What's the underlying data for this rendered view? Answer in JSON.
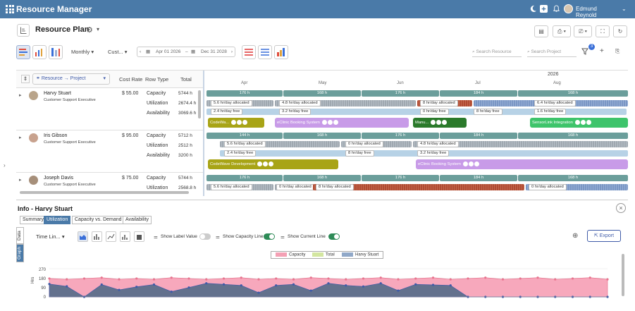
{
  "app": {
    "title": "Resource Manager",
    "user": "Edmund Reynold"
  },
  "page": {
    "title": "Resource Plan"
  },
  "toolbar": {
    "view_mode": "Monthly",
    "range_mode": "Cust...",
    "start_date": "Apr 01 2026",
    "end_date": "Dec 31 2028",
    "search_resource_placeholder": "Search Resource",
    "search_project_placeholder": "Search Project",
    "filter_count": "3"
  },
  "grid": {
    "headers": {
      "group": "Resource → Project",
      "cost": "Cost Rate",
      "row_type": "Row Type",
      "total": "Total"
    },
    "year": "2026",
    "months": [
      "Apr",
      "May",
      "Jun",
      "Jul",
      "Aug"
    ],
    "resources": [
      {
        "name": "Harvy Stuart",
        "role": "Customer Support Executive",
        "cost": "$ 55.00",
        "rows": [
          {
            "type": "Capacity",
            "total": "5744 h"
          },
          {
            "type": "Utilization",
            "total": "2674.4 h"
          },
          {
            "type": "Availability",
            "total": "3069.6 h"
          }
        ],
        "capacity": [
          "176 h",
          "168 h",
          "176 h",
          "184 h",
          "168 h"
        ],
        "utilization": [
          "5.6 hr/day allocated",
          "4.8 hr/day allocated",
          "8 hr/day allocated",
          "6.4 hr/day allocated"
        ],
        "availability": [
          "2.4 hr/day free",
          "3.2 hr/day free",
          "0 hr/day free",
          "8 hr/day free",
          "1.6 hr/day free"
        ],
        "projects": [
          "CodeWa...",
          "eClinic Booking System",
          "Manu...",
          "SensorLink Integration"
        ]
      },
      {
        "name": "Iris Gibson",
        "role": "Customer Support Executive",
        "cost": "$ 95.00",
        "rows": [
          {
            "type": "Capacity",
            "total": "5712 h"
          },
          {
            "type": "Utilization",
            "total": "2512 h"
          },
          {
            "type": "Availability",
            "total": "3200 h"
          }
        ],
        "capacity": [
          "144 h",
          "168 h",
          "176 h",
          "184 h",
          "168 h"
        ],
        "utilization": [
          "5.6 hr/day allocated",
          "0 hr/day allocated",
          "4.8 hr/day allocated"
        ],
        "availability": [
          "2.4 hr/day free",
          "8 hr/day free",
          "3.2 hr/day free"
        ],
        "projects": [
          "CodeWave Development",
          "eClinic Booking System"
        ]
      },
      {
        "name": "Joseph Davis",
        "role": "Customer Support Executive",
        "cost": "$ 75.00",
        "rows": [
          {
            "type": "Capacity",
            "total": "5744 h"
          },
          {
            "type": "Utilization",
            "total": "2568.8 h"
          }
        ],
        "capacity": [
          "176 h",
          "168 h",
          "176 h",
          "184 h",
          "168 h"
        ],
        "utilization": [
          "5.6 hr/day allocated",
          "0 hr/day allocated",
          "8 hr/day allocated",
          "0 hr/day allocated"
        ]
      }
    ]
  },
  "info": {
    "title": "Info - Harvy Stuart",
    "tabs": [
      "Summary",
      "Utilization",
      "Capacity vs. Demand",
      "Availability"
    ],
    "active_tab": "Utilization",
    "side_tabs": [
      "Data",
      "Graph"
    ],
    "period_select": "Time Lin...",
    "show_label_value": "Show Label Value",
    "show_capacity_line": "Show Capacity Line",
    "show_current_line": "Show Current Line",
    "export": "Export",
    "legend": [
      "Capacity",
      "Total",
      "Harvy Stuart"
    ],
    "ylabel": "Hrs",
    "yticks": [
      "270",
      "180",
      "90",
      "0"
    ]
  },
  "colors": {
    "primary": "#4a7aa8",
    "capacity": "#f4a0b4",
    "resource": "#5b6e8a"
  },
  "chart_data": {
    "type": "area",
    "ylabel": "Hrs",
    "ylim": [
      0,
      270
    ],
    "series": [
      {
        "name": "Capacity",
        "values": [
          176,
          168,
          176,
          184,
          168,
          176,
          168,
          184,
          176,
          168,
          176,
          184,
          168,
          176,
          168,
          184,
          176,
          168,
          176,
          184,
          168,
          176,
          184,
          168,
          176,
          184,
          168,
          176,
          184,
          168,
          176,
          184,
          168
        ]
      },
      {
        "name": "Harvy Stuart",
        "values": [
          123,
          101,
          0,
          118,
          67,
          96,
          118,
          50,
          90,
          130,
          120,
          110,
          40,
          110,
          120,
          60,
          130,
          110,
          100,
          130,
          60,
          120,
          115,
          110,
          0,
          0,
          0,
          0,
          0,
          0,
          0,
          0,
          0
        ]
      }
    ]
  }
}
